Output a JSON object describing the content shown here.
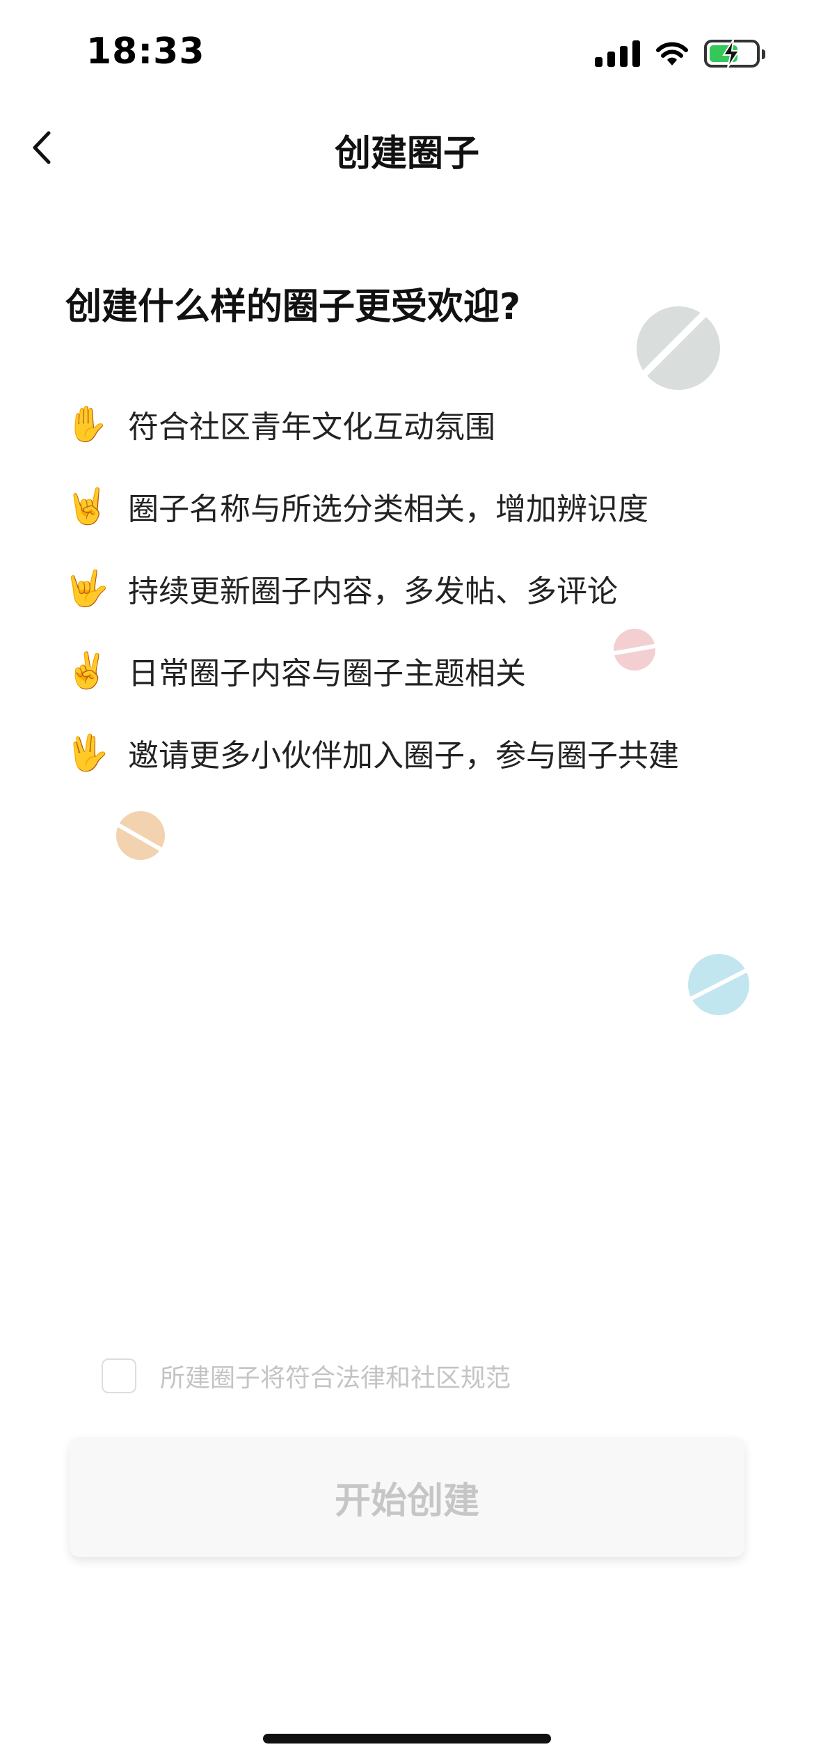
{
  "status_bar": {
    "time": "18:33",
    "icons": [
      "signal-icon",
      "wifi-icon",
      "battery-charging-icon"
    ],
    "battery_color": "#34c759"
  },
  "nav": {
    "title": "创建圈子",
    "back_icon": "chevron-left-icon"
  },
  "headline": "创建什么样的圈子更受欢迎?",
  "tips": [
    {
      "emoji": "✋",
      "text": "符合社区青年文化互动氛围"
    },
    {
      "emoji": "🤘",
      "text": "圈子名称与所选分类相关，增加辨识度"
    },
    {
      "emoji": "🤟",
      "text": "持续更新圈子内容，多发帖、多评论"
    },
    {
      "emoji": "✌️",
      "text": "日常圈子内容与圈子主题相关"
    },
    {
      "emoji": "🖖",
      "text": "邀请更多小伙伴加入圈子，参与圈子共建"
    }
  ],
  "decor": {
    "planet_colors": [
      "#d9dedd",
      "#f4cfd1",
      "#f3d2b0",
      "#c2e6ef"
    ]
  },
  "agreement": {
    "checked": false,
    "label": "所建圈子将符合法律和社区规范"
  },
  "cta": {
    "label": "开始创建",
    "enabled": false
  }
}
